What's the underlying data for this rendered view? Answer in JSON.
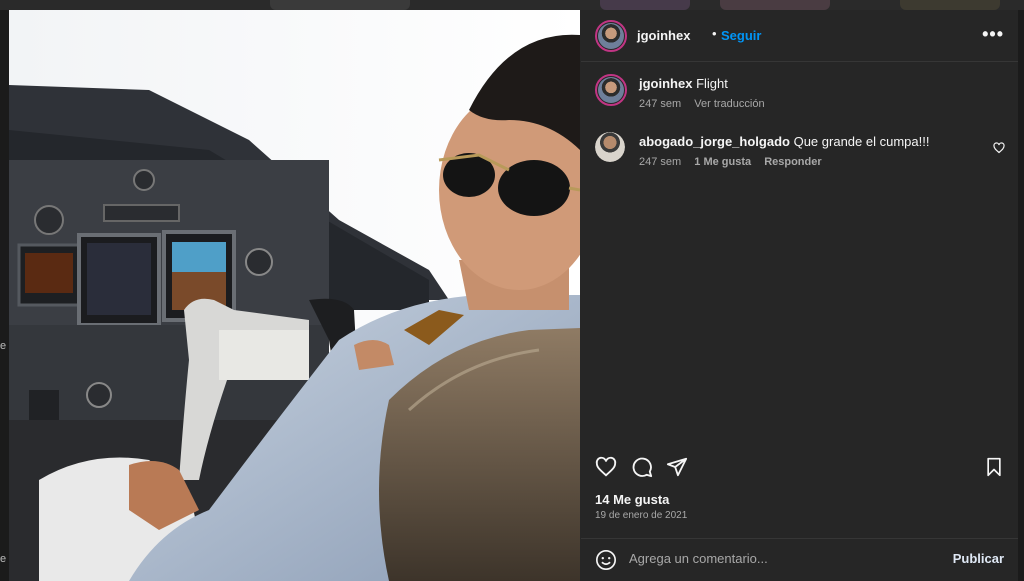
{
  "post": {
    "author": "jgoinhex",
    "separator": "•",
    "follow_label": "Seguir",
    "more_label": "•••",
    "caption": {
      "username": "jgoinhex",
      "text": "Flight",
      "time": "247 sem",
      "translate_label": "Ver traducción"
    },
    "comments": [
      {
        "username": "abogado_jorge_holgado",
        "text": "Que grande el cumpa!!!",
        "time": "247 sem",
        "likes_label": "1 Me gusta",
        "reply_label": "Responder"
      }
    ],
    "likes_label": "14 Me gusta",
    "date": "19 de enero de 2021",
    "composer": {
      "placeholder": "Agrega un comentario...",
      "publish_label": "Publicar"
    }
  },
  "icons": {
    "like": "heart-icon",
    "comment": "comment-icon",
    "share": "send-icon",
    "save": "bookmark-icon",
    "emoji": "emoji-icon",
    "comment_like": "heart-small-icon"
  },
  "colors": {
    "panel_bg": "#262626",
    "accent_link": "#0095f6",
    "muted_text": "#a8a8a8",
    "story_ring": "#c13584"
  },
  "background_page": {
    "gutter_letters": [
      "e",
      "e"
    ]
  }
}
